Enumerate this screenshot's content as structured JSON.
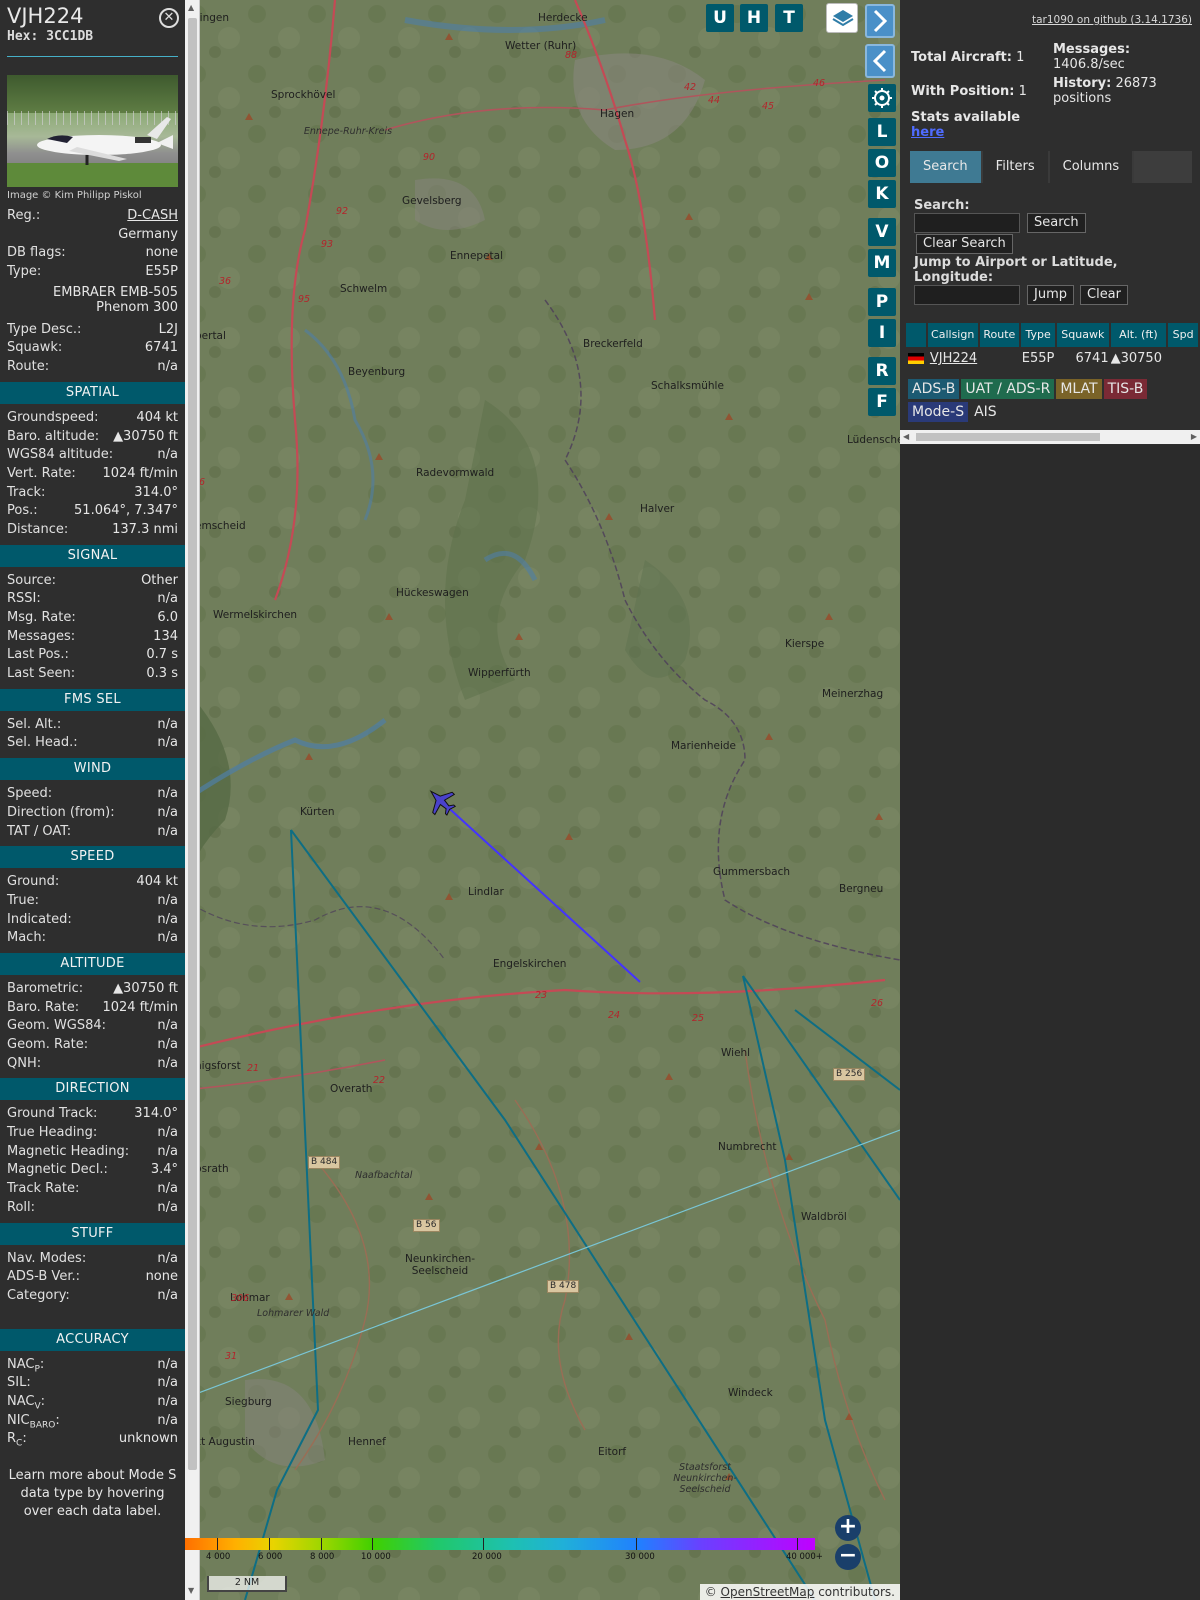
{
  "aircraft": {
    "callsign": "VJH224",
    "hex_label": "Hex:",
    "hex": "3CC1DB",
    "photo_credit": "Image © Kim Philipp Piskol",
    "reg_label": "Reg.:",
    "reg": "D-CASH",
    "country": "Germany",
    "dbflags_label": "DB flags:",
    "dbflags": "none",
    "type_label": "Type:",
    "type": "E55P",
    "type_name_1": "EMBRAER EMB-505",
    "type_name_2": "Phenom 300",
    "typedesc_label": "Type Desc.:",
    "typedesc": "L2J",
    "squawk_label": "Squawk:",
    "squawk": "6741",
    "route_label": "Route:",
    "route": "n/a"
  },
  "spatial": {
    "title": "SPATIAL",
    "rows": [
      {
        "k": "Groundspeed:",
        "v": "404 kt"
      },
      {
        "k": "Baro. altitude:",
        "v": "▲30750 ft"
      },
      {
        "k": "WGS84 altitude:",
        "v": "n/a"
      },
      {
        "k": "Vert. Rate:",
        "v": "1024 ft/min"
      },
      {
        "k": "Track:",
        "v": "314.0°"
      },
      {
        "k": "Pos.:",
        "v": "51.064°, 7.347°"
      },
      {
        "k": "Distance:",
        "v": "137.3 nmi"
      }
    ]
  },
  "signal": {
    "title": "SIGNAL",
    "rows": [
      {
        "k": "Source:",
        "v": "Other"
      },
      {
        "k": "RSSI:",
        "v": "n/a"
      },
      {
        "k": "Msg. Rate:",
        "v": "6.0"
      },
      {
        "k": "Messages:",
        "v": "134"
      },
      {
        "k": "Last Pos.:",
        "v": "0.7 s"
      },
      {
        "k": "Last Seen:",
        "v": "0.3 s"
      }
    ]
  },
  "fms": {
    "title": "FMS SEL",
    "rows": [
      {
        "k": "Sel. Alt.:",
        "v": "n/a"
      },
      {
        "k": "Sel. Head.:",
        "v": "n/a"
      }
    ]
  },
  "wind": {
    "title": "WIND",
    "rows": [
      {
        "k": "Speed:",
        "v": "n/a"
      },
      {
        "k": "Direction (from):",
        "v": "n/a"
      },
      {
        "k": "TAT / OAT:",
        "v": "n/a"
      }
    ]
  },
  "speed": {
    "title": "SPEED",
    "rows": [
      {
        "k": "Ground:",
        "v": "404 kt"
      },
      {
        "k": "True:",
        "v": "n/a"
      },
      {
        "k": "Indicated:",
        "v": "n/a"
      },
      {
        "k": "Mach:",
        "v": "n/a"
      }
    ]
  },
  "altitude": {
    "title": "ALTITUDE",
    "rows": [
      {
        "k": "Barometric:",
        "v": "▲30750 ft"
      },
      {
        "k": "Baro. Rate:",
        "v": "1024 ft/min"
      },
      {
        "k": "Geom. WGS84:",
        "v": "n/a"
      },
      {
        "k": "Geom. Rate:",
        "v": "n/a"
      },
      {
        "k": "QNH:",
        "v": "n/a"
      }
    ]
  },
  "direction": {
    "title": "DIRECTION",
    "rows": [
      {
        "k": "Ground Track:",
        "v": "314.0°"
      },
      {
        "k": "True Heading:",
        "v": "n/a"
      },
      {
        "k": "Magnetic Heading:",
        "v": "n/a"
      },
      {
        "k": "Magnetic Decl.:",
        "v": "3.4°"
      },
      {
        "k": "Track Rate:",
        "v": "n/a"
      },
      {
        "k": "Roll:",
        "v": "n/a"
      }
    ]
  },
  "stuff": {
    "title": "STUFF",
    "rows": [
      {
        "k": "Nav. Modes:",
        "v": "n/a"
      },
      {
        "k": "ADS-B Ver.:",
        "v": "none"
      },
      {
        "k": "Category:",
        "v": "n/a"
      }
    ]
  },
  "accuracy": {
    "title": "ACCURACY",
    "rows": [
      {
        "k": "NACP:",
        "v": "n/a"
      },
      {
        "k": "SIL:",
        "v": "n/a"
      },
      {
        "k": "NACV:",
        "v": "n/a"
      },
      {
        "k": "NICBARO:",
        "v": "n/a"
      },
      {
        "k": "RC:",
        "v": "unknown"
      }
    ]
  },
  "footer": "Learn more about Mode S data type by hovering over each data label.",
  "map": {
    "toolbar": [
      "U",
      "H",
      "T"
    ],
    "side_buttons": [
      "L",
      "O",
      "K",
      "V",
      "M",
      "P",
      "I",
      "R",
      "F"
    ],
    "places": [
      {
        "name": "attingen"
      },
      {
        "name": "Herdecke"
      },
      {
        "name": "Wetter (Ruhr)"
      },
      {
        "name": "Sprockhövel"
      },
      {
        "name": "Hagen"
      },
      {
        "name": "Ennepe-Ruhr-Kreis"
      },
      {
        "name": "Gevelsberg"
      },
      {
        "name": "Ennepetal"
      },
      {
        "name": "Schwelm"
      },
      {
        "name": "pertal"
      },
      {
        "name": "Breckerfeld"
      },
      {
        "name": "Beyenburg"
      },
      {
        "name": "Schalksmühle"
      },
      {
        "name": "Lüdenscheid"
      },
      {
        "name": "Radevormwald"
      },
      {
        "name": "Halver"
      },
      {
        "name": "emscheid"
      },
      {
        "name": "Hückeswagen"
      },
      {
        "name": "Wermelskirchen"
      },
      {
        "name": "Kierspe"
      },
      {
        "name": "Wipperfürth"
      },
      {
        "name": "Meinerzhag"
      },
      {
        "name": "Marienheide"
      },
      {
        "name": "Kürten"
      },
      {
        "name": "Gummersbach"
      },
      {
        "name": "Bergneu"
      },
      {
        "name": "Lindlar"
      },
      {
        "name": "Engelskirchen"
      },
      {
        "name": "Wiehl"
      },
      {
        "name": "Overath"
      },
      {
        "name": "Numbrecht"
      },
      {
        "name": "Waldbröl"
      },
      {
        "name": "psrath"
      },
      {
        "name": "Naafbachtal"
      },
      {
        "name": "Neunkirchen-Seelscheid"
      },
      {
        "name": "Lohmar"
      },
      {
        "name": "Lohmarer Wald"
      },
      {
        "name": "Windeck"
      },
      {
        "name": "Siegburg"
      },
      {
        "name": "kt Augustin"
      },
      {
        "name": "Hennef"
      },
      {
        "name": "Eitorf"
      },
      {
        "name": "Staatsforst Neunkirchen-Seelscheid"
      },
      {
        "name": "nigsforst"
      },
      {
        "name": "Hagen"
      }
    ],
    "shields": [
      "B 256",
      "B 484",
      "B 56",
      "B 478"
    ],
    "road_numbers": [
      "88",
      "90",
      "92",
      "93",
      "36",
      "95",
      "96",
      "23",
      "24",
      "25",
      "26",
      "22",
      "21",
      "42",
      "44",
      "45",
      "46",
      "306",
      "31"
    ],
    "alt_ticks": [
      "4 000",
      "6 000",
      "8 000",
      "10 000",
      "20 000",
      "30 000",
      "40 000+"
    ],
    "scale": "2 NM",
    "attribution_prefix": "© ",
    "attribution_link": "OpenStreetMap",
    "attribution_suffix": " contributors."
  },
  "sidebar": {
    "version": "tar1090 on github (3.14.1736)",
    "total_aircraft_label": "Total Aircraft:",
    "total_aircraft": "1",
    "with_position_label": "With Position:",
    "with_position": "1",
    "stats_label": "Stats available",
    "stats_link": "here",
    "messages_label": "Messages:",
    "messages_value": "1406.8/sec",
    "history_label": "History:",
    "history_value": "26873",
    "history_unit": "positions",
    "tabs": [
      "Search",
      "Filters",
      "Columns"
    ],
    "search_label": "Search:",
    "search_button": "Search",
    "clear_search_button": "Clear Search",
    "jump_label": "Jump to Airport or Latitude, Longitude:",
    "jump_button": "Jump",
    "clear_button": "Clear",
    "table_headers": [
      "",
      "Callsign",
      "Route",
      "Type",
      "Squawk",
      "Alt. (ft)",
      "Spd"
    ],
    "row": {
      "callsign": "VJH224",
      "route": "",
      "type": "E55P",
      "squawk": "6741",
      "alt": "▲30750",
      "spd": ""
    },
    "sources": [
      "ADS-B",
      "UAT / ADS-R",
      "MLAT",
      "TIS-B",
      "Mode-S",
      "AIS"
    ]
  },
  "colors": {
    "section": "#00596b",
    "track": "#4433ff",
    "range_ring": "#0e6e84",
    "adsb": "#1c5a72",
    "uat": "#1f6b4e",
    "mlat": "#7a6328",
    "tisb": "#7a2a35",
    "modes": "#2a3a78"
  }
}
